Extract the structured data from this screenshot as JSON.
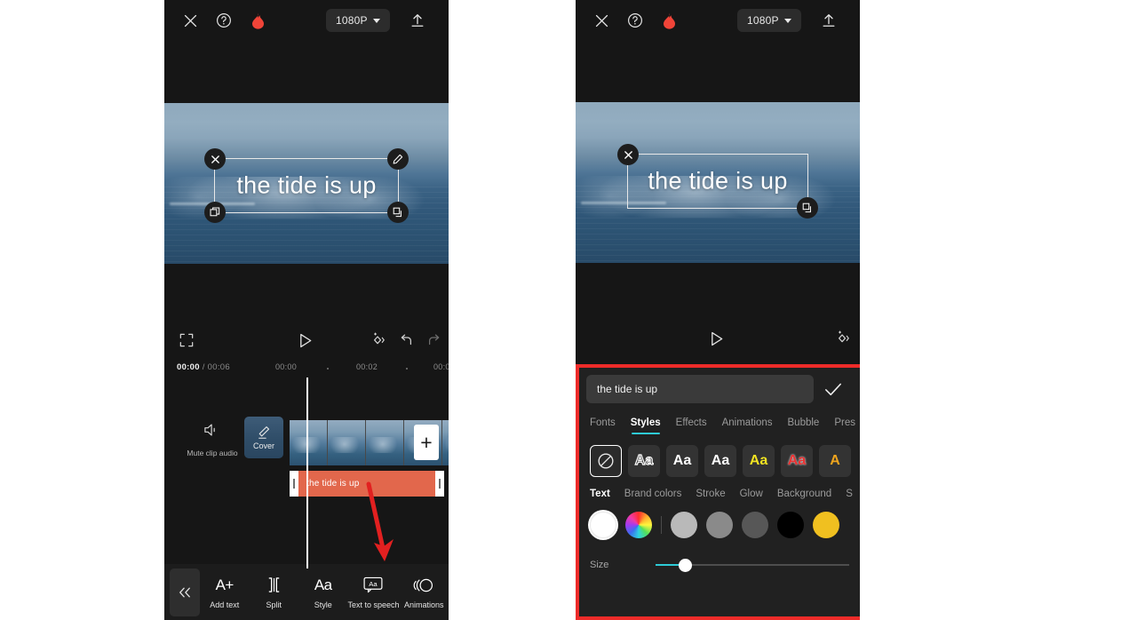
{
  "header": {
    "close_icon": "close-icon",
    "help_icon": "help-circle-icon",
    "pro_icon": "flame-icon",
    "resolution": "1080P",
    "export_icon": "upload-icon"
  },
  "preview": {
    "overlay_text": "the tide is up",
    "handles": {
      "delete": "close-icon",
      "edit": "pencil-icon",
      "duplicate": "copy-icon",
      "resize": "resize-icon"
    }
  },
  "controls_left": {
    "fullscreen": "expand-icon",
    "play": "play-icon",
    "magic": "magic-wand-icon",
    "undo": "undo-icon",
    "redo": "redo-icon"
  },
  "controls_right": {
    "play": "play-icon",
    "magic": "magic-wand-icon"
  },
  "timeline": {
    "current_time": "00:00",
    "total_time": "00:06",
    "separator": "/",
    "ruler_ticks": [
      "00:00",
      "00:02",
      "00:0"
    ],
    "mute_label": "Mute clip audio",
    "mute_icon": "speaker-mute-icon",
    "cover_label": "Cover",
    "cover_icon": "pencil-icon",
    "add_clip_label": "+",
    "text_clip_label": "the tide is up",
    "text_clip_color": "#e2674c"
  },
  "toolbar": {
    "collapse_icon": "chevron-double-left-icon",
    "items": [
      {
        "label": "Add text",
        "icon": "add-text-icon",
        "glyph": "A+"
      },
      {
        "label": "Split",
        "icon": "split-icon",
        "glyph": "]["
      },
      {
        "label": "Style",
        "icon": "style-icon",
        "glyph": "Aa"
      },
      {
        "label": "Text to speech",
        "icon": "text-to-speech-icon",
        "glyph": "Aa"
      },
      {
        "label": "Animations",
        "icon": "animations-icon",
        "glyph": "((O"
      }
    ]
  },
  "editor_sheet": {
    "highlight_color": "#ee2b29",
    "text_value": "the tide is up",
    "confirm_icon": "check-icon",
    "tabs": [
      {
        "label": "Fonts",
        "active": false
      },
      {
        "label": "Styles",
        "active": true
      },
      {
        "label": "Effects",
        "active": false
      },
      {
        "label": "Animations",
        "active": false
      },
      {
        "label": "Bubble",
        "active": false
      },
      {
        "label": "Pres",
        "active": false
      }
    ],
    "active_tab_underline_color": "#2ecbd6",
    "style_swatches": [
      {
        "name": "none",
        "glyph": "",
        "selected": true
      },
      {
        "name": "white-shadow",
        "glyph": "Aa",
        "selected": false
      },
      {
        "name": "outline",
        "glyph": "Aa",
        "selected": false
      },
      {
        "name": "white-plain",
        "glyph": "Aa",
        "selected": false
      },
      {
        "name": "white-bold",
        "glyph": "Aa",
        "selected": false
      },
      {
        "name": "yellow",
        "glyph": "Aa",
        "selected": false
      },
      {
        "name": "red",
        "glyph": "Aa",
        "selected": false
      },
      {
        "name": "orange",
        "glyph": "A",
        "selected": false
      }
    ],
    "sub_tabs": [
      {
        "label": "Text",
        "active": true
      },
      {
        "label": "Brand colors",
        "active": false
      },
      {
        "label": "Stroke",
        "active": false
      },
      {
        "label": "Glow",
        "active": false
      },
      {
        "label": "Background",
        "active": false
      },
      {
        "label": "S",
        "active": false
      }
    ],
    "color_tools": {
      "eyedropper_icon": "eyedropper-icon",
      "color_wheel_icon": "color-wheel-icon"
    },
    "color_swatches": [
      {
        "name": "white",
        "hex": "#ffffff",
        "selected": true
      },
      {
        "name": "light-gray",
        "hex": "#b9b9b9",
        "selected": false
      },
      {
        "name": "medium-gray",
        "hex": "#8a8a8a",
        "selected": false
      },
      {
        "name": "dark-gray",
        "hex": "#575757",
        "selected": false
      },
      {
        "name": "black",
        "hex": "#000000",
        "selected": false
      },
      {
        "name": "yellow",
        "hex": "#f0c020",
        "selected": false
      }
    ],
    "size_label": "Size",
    "size_value": 14,
    "size_track_color": "#2ecbd6"
  },
  "annotation": {
    "arrow_color": "#e22020"
  }
}
